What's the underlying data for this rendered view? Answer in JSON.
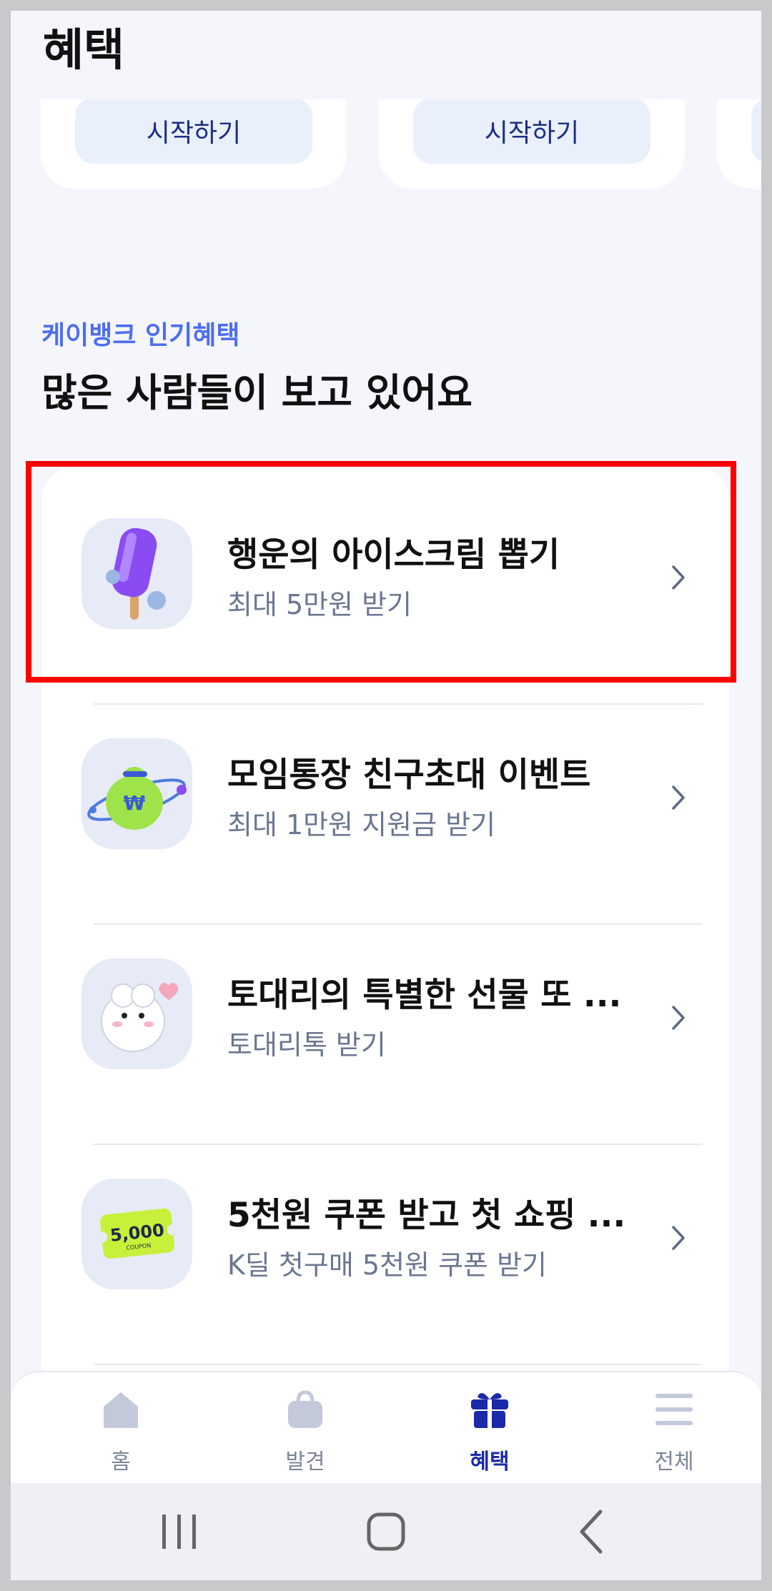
{
  "header": {
    "title": "혜택"
  },
  "top_cards": [
    {
      "button_label": "시작하기"
    },
    {
      "button_label": "시작하기"
    }
  ],
  "section": {
    "label": "케이뱅크 인기혜택",
    "title": "많은 사람들이 보고 있어요"
  },
  "items": [
    {
      "title": "행운의 아이스크림 뽑기",
      "subtitle": "최대 5만원 받기",
      "icon": "ice-cream-icon"
    },
    {
      "title": "모임통장 친구초대 이벤트",
      "subtitle": "최대 1만원 지원금 받기",
      "icon": "money-bag-icon"
    },
    {
      "title": "토대리의 특별한 선물 또 ...",
      "subtitle": "토대리톡 받기",
      "icon": "character-icon"
    },
    {
      "title": "5천원 쿠폰 받고 첫 쇼핑 ...",
      "subtitle": "K딜 첫구매 5천원 쿠폰 받기",
      "icon": "coupon-icon",
      "coupon_amount": "5,000",
      "coupon_text": "COUPON"
    }
  ],
  "tabs": [
    {
      "label": "홈",
      "icon": "home-icon"
    },
    {
      "label": "발견",
      "icon": "shopping-bag-icon"
    },
    {
      "label": "혜택",
      "icon": "gift-icon",
      "active": true
    },
    {
      "label": "전체",
      "icon": "menu-icon"
    }
  ],
  "colors": {
    "accent": "#4d6ef0",
    "active_tab": "#1b2aa8",
    "highlight": "#ff0000",
    "background": "#f4f6fb"
  }
}
